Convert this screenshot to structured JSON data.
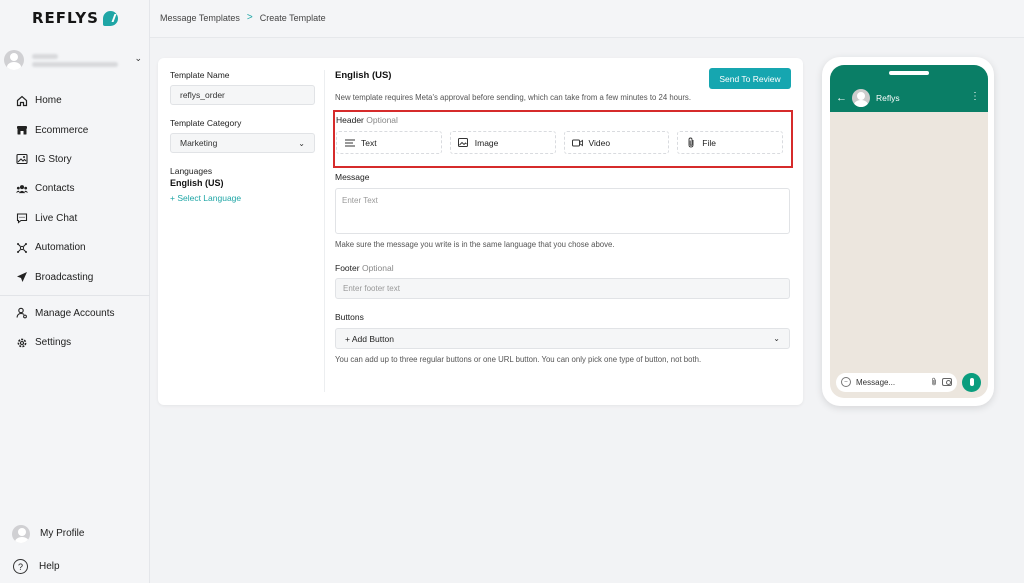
{
  "brand": {
    "name": "REFLYS",
    "accent": "#1fa6a6"
  },
  "sidebar": {
    "items": [
      {
        "label": "Home",
        "icon": "home-icon"
      },
      {
        "label": "Ecommerce",
        "icon": "store-icon"
      },
      {
        "label": "IG Story",
        "icon": "image-icon"
      },
      {
        "label": "Contacts",
        "icon": "users-icon"
      },
      {
        "label": "Live Chat",
        "icon": "chat-icon"
      },
      {
        "label": "Automation",
        "icon": "automation-icon"
      },
      {
        "label": "Broadcasting",
        "icon": "send-icon"
      }
    ],
    "secondary": [
      {
        "label": "Manage Accounts",
        "icon": "user-manage-icon"
      },
      {
        "label": "Settings",
        "icon": "gear-icon"
      }
    ],
    "bottom": {
      "profile": "My Profile",
      "help": "Help",
      "help_glyph": "?"
    }
  },
  "breadcrumb": {
    "parent": "Message Templates",
    "separator": ">",
    "current": "Create Template"
  },
  "form": {
    "template_name_label": "Template Name",
    "template_name_value": "reflys_order",
    "category_label": "Template Category",
    "category_value": "Marketing",
    "languages_label": "Languages",
    "language_value": "English (US)",
    "add_language": "+ Select Language"
  },
  "editor": {
    "language_title": "English (US)",
    "send_button": "Send To Review",
    "approval_note": "New template requires Meta's approval before sending, which can take from a few minutes to 24 hours.",
    "header_label": "Header",
    "optional": "Optional",
    "header_options": [
      {
        "label": "Text",
        "icon": "text-lines-icon"
      },
      {
        "label": "Image",
        "icon": "image-icon"
      },
      {
        "label": "Video",
        "icon": "video-icon"
      },
      {
        "label": "File",
        "icon": "paperclip-icon"
      }
    ],
    "message_label": "Message",
    "message_placeholder": "Enter Text",
    "message_help": "Make sure the message you write is in the same language that you chose above.",
    "footer_label": "Footer",
    "footer_placeholder": "Enter footer text",
    "buttons_label": "Buttons",
    "buttons_select": "+ Add Button",
    "buttons_help": "You can add up to three regular buttons or one URL button. You can only pick one type of button, not both.",
    "highlight_color": "#d62b2b",
    "button_color": "#16a6b0"
  },
  "preview": {
    "contact_name": "Reflys",
    "input_placeholder": "Message...",
    "header_color": "#0a7e66",
    "chat_bg": "#ece6de"
  }
}
